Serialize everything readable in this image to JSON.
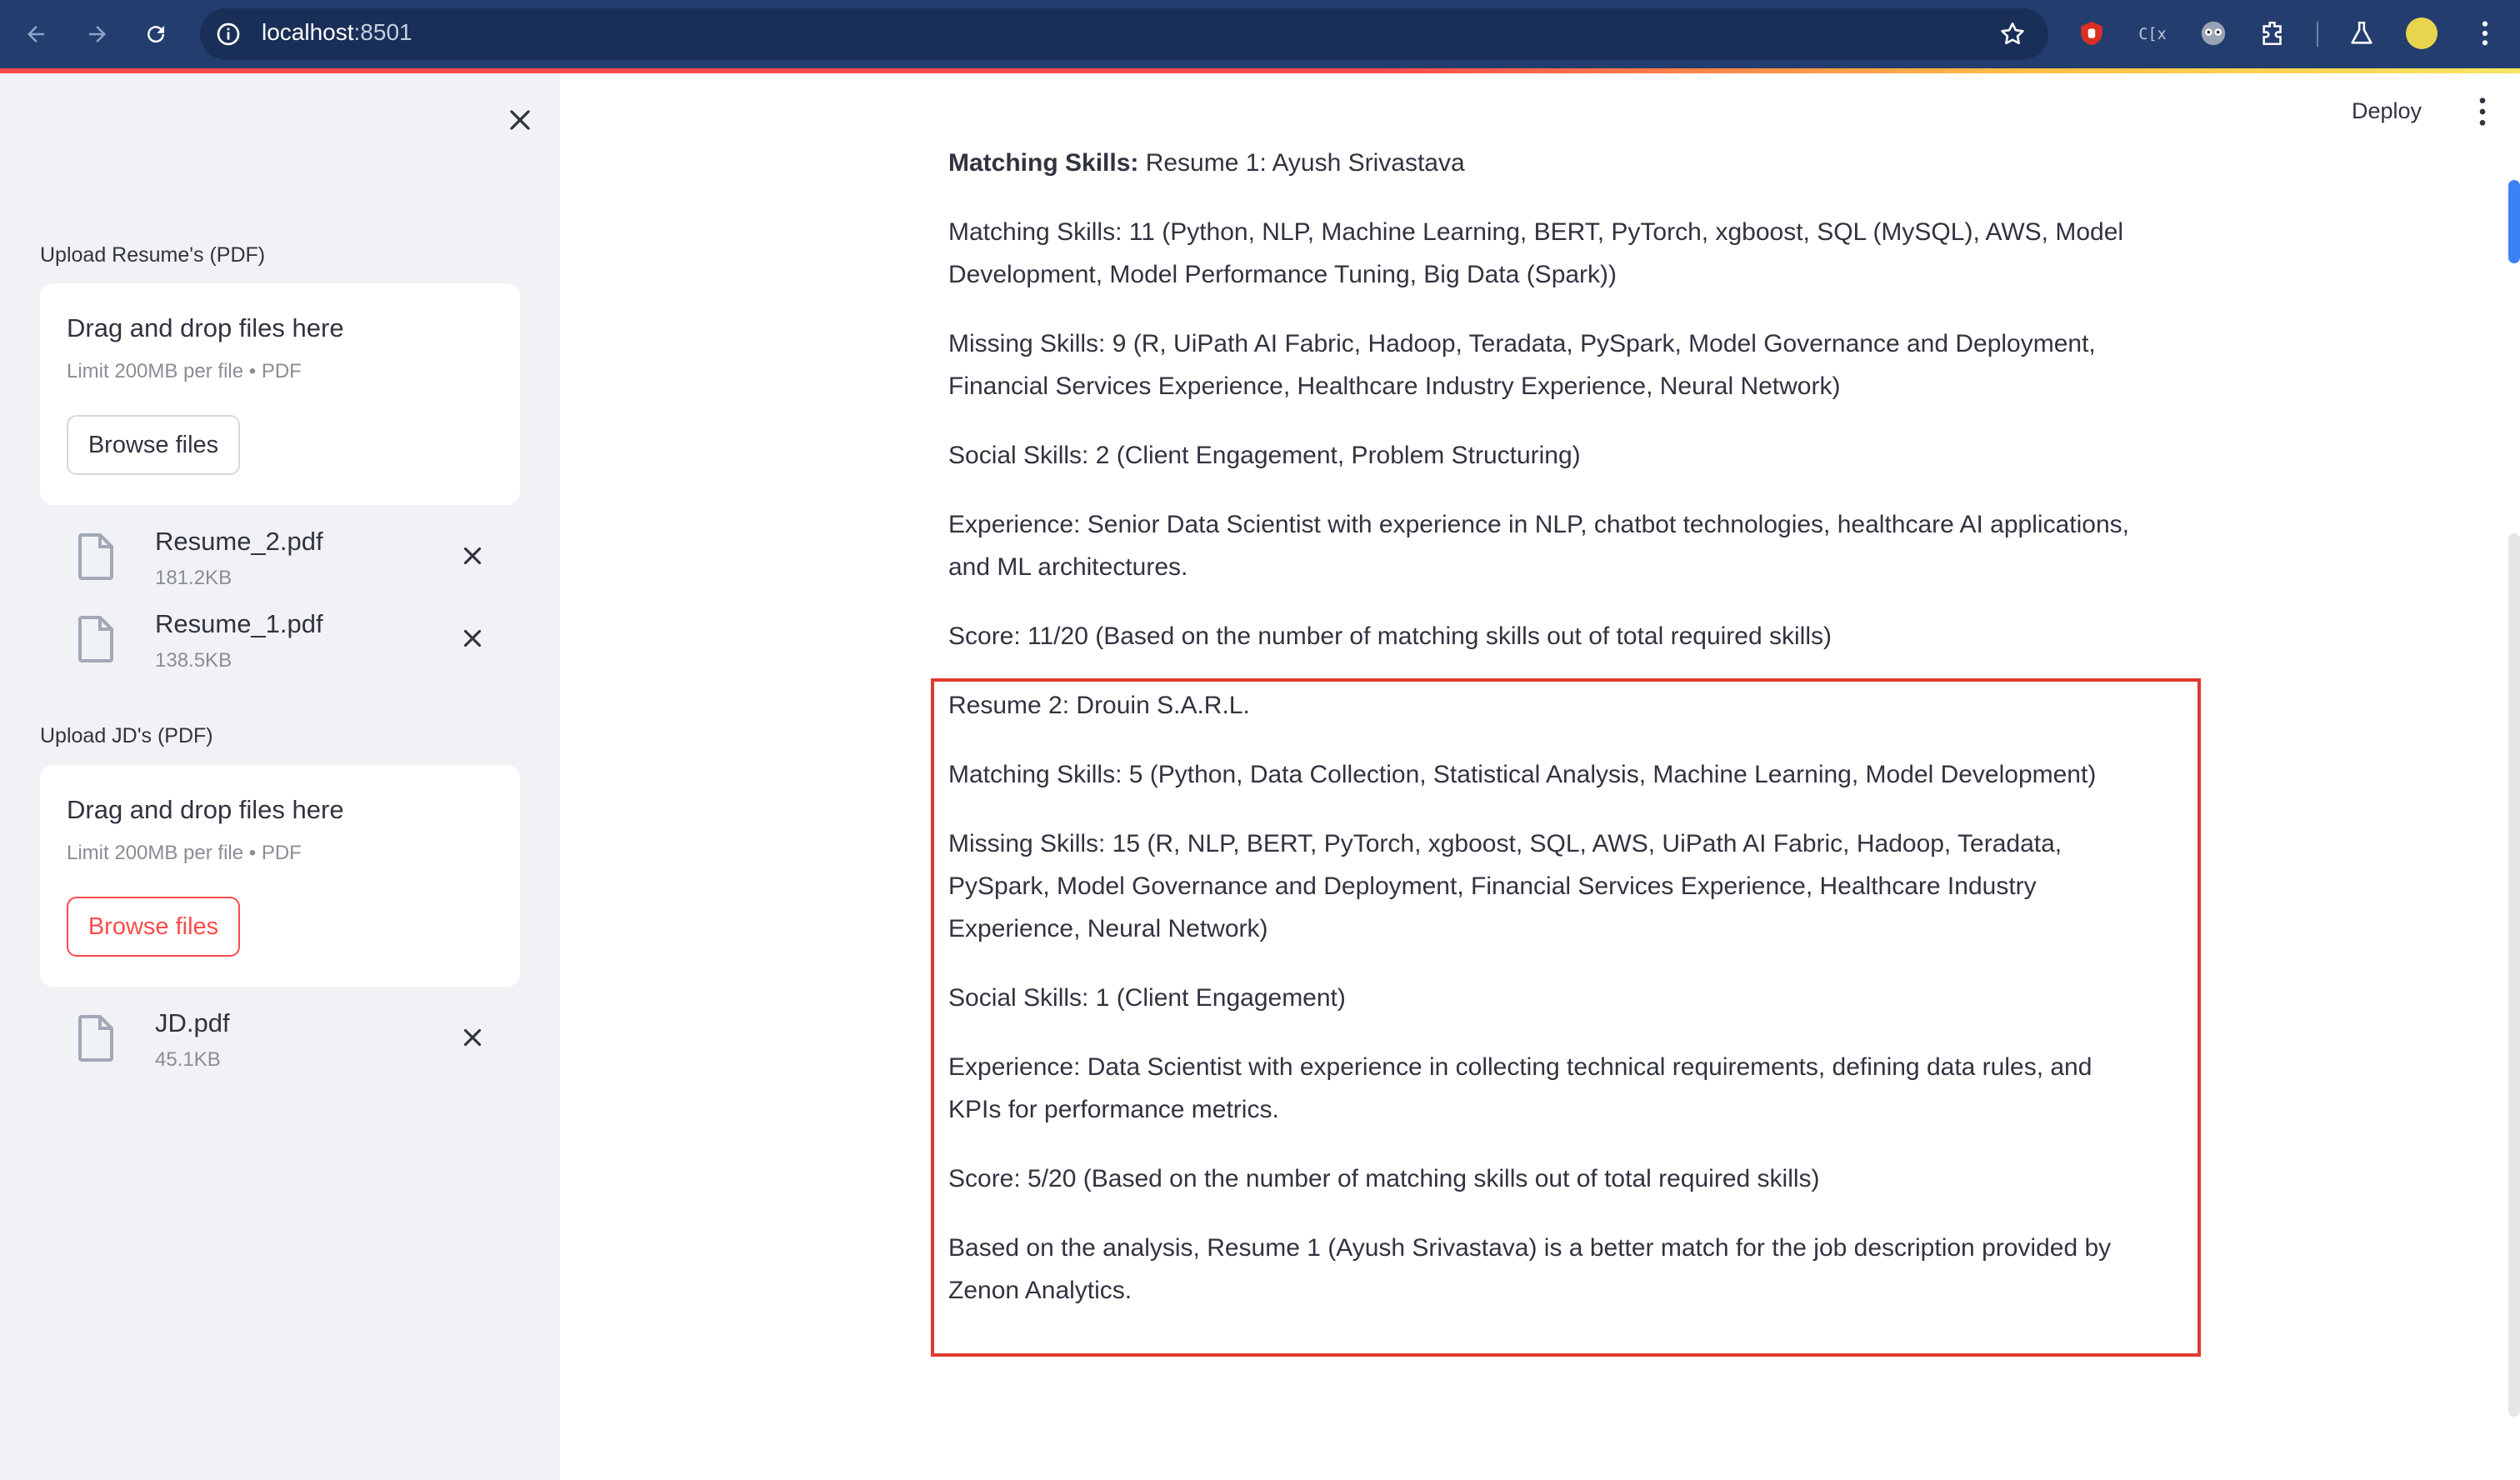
{
  "browser": {
    "url_host": "localhost",
    "url_port": ":8501"
  },
  "sidebar": {
    "resume_uploader": {
      "label": "Upload Resume's (PDF)",
      "drop_title": "Drag and drop files here",
      "drop_limit": "Limit 200MB per file • PDF",
      "browse_label": "Browse files",
      "files": [
        {
          "name": "Resume_2.pdf",
          "size": "181.2KB"
        },
        {
          "name": "Resume_1.pdf",
          "size": "138.5KB"
        }
      ]
    },
    "jd_uploader": {
      "label": "Upload JD's (PDF)",
      "drop_title": "Drag and drop files here",
      "drop_limit": "Limit 200MB per file • PDF",
      "browse_label": "Browse files",
      "files": [
        {
          "name": "JD.pdf",
          "size": "45.1KB"
        }
      ]
    }
  },
  "header": {
    "deploy_label": "Deploy"
  },
  "main": {
    "resume1": {
      "heading_bold": "Matching Skills:",
      "heading_rest": " Resume 1: Ayush Srivastava",
      "matching": "Matching Skills: 11 (Python, NLP, Machine Learning, BERT, PyTorch, xgboost, SQL (MySQL), AWS, Model Development, Model Performance Tuning, Big Data (Spark))",
      "missing": "Missing Skills: 9 (R, UiPath AI Fabric, Hadoop, Teradata, PySpark, Model Governance and Deployment, Financial Services Experience, Healthcare Industry Experience, Neural Network)",
      "social": "Social Skills: 2 (Client Engagement, Problem Structuring)",
      "experience": "Experience: Senior Data Scientist with experience in NLP, chatbot technologies, healthcare AI applications, and ML architectures.",
      "score": "Score: 11/20 (Based on the number of matching skills out of total required skills)"
    },
    "resume2": {
      "heading": "Resume 2: Drouin S.A.R.L.",
      "matching": "Matching Skills: 5 (Python, Data Collection, Statistical Analysis, Machine Learning, Model Development)",
      "missing": "Missing Skills: 15 (R, NLP, BERT, PyTorch, xgboost, SQL, AWS, UiPath AI Fabric, Hadoop, Teradata, PySpark, Model Governance and Deployment, Financial Services Experience, Healthcare Industry Experience, Neural Network)",
      "social": "Social Skills: 1 (Client Engagement)",
      "experience": "Experience: Data Scientist with experience in collecting technical requirements, defining data rules, and KPIs for performance metrics.",
      "score": "Score: 5/20 (Based on the number of matching skills out of total required skills)"
    },
    "conclusion": "Based on the analysis, Resume 1 (Ayush Srivastava) is a better match for the job description provided by Zenon Analytics."
  }
}
